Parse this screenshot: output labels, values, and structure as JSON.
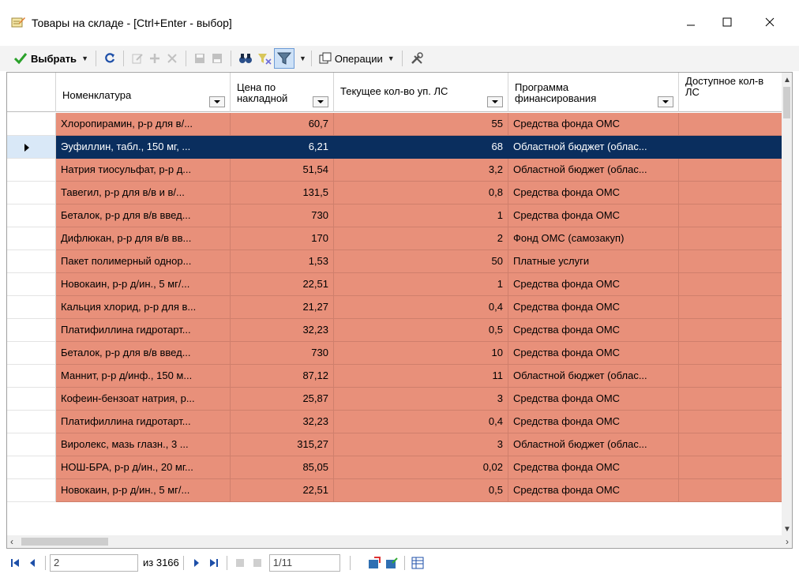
{
  "window": {
    "title": "Товары на складе - [Ctrl+Enter - выбор]",
    "icons": {
      "app": "notepad-pencil-icon",
      "minimize": "minimize-icon",
      "maximize": "maximize-icon",
      "close": "close-icon"
    }
  },
  "toolbar": {
    "select_label": "Выбрать",
    "operations_label": "Операции",
    "icons": [
      "checkmark-icon",
      "refresh-icon",
      "edit-icon",
      "add-icon",
      "delete-icon",
      "save-icon",
      "save-all-icon",
      "binoculars-icon",
      "filter-clear-icon",
      "filter-icon",
      "operations-icon",
      "tools-icon"
    ]
  },
  "grid": {
    "columns": [
      {
        "label": "Номенклатура"
      },
      {
        "label": "Цена по накладной"
      },
      {
        "label": "Текущее кол-во уп. ЛС"
      },
      {
        "label": "Программа финансирования"
      },
      {
        "label": "Доступное кол-в ЛС"
      }
    ],
    "rows": [
      {
        "name": "Хлоропирамин, р-р для в/...",
        "price": "60,7",
        "qty": "55",
        "program": "Средства фонда ОМС"
      },
      {
        "name": "Эуфиллин, табл., 150 мг, ...",
        "price": "6,21",
        "qty": "68",
        "program": "Областной бюджет (облас...",
        "selected": true
      },
      {
        "name": "Натрия тиосульфат, р-р д...",
        "price": "51,54",
        "qty": "3,2",
        "program": "Областной бюджет (облас..."
      },
      {
        "name": "Тавегил, р-р для в/в и в/...",
        "price": "131,5",
        "qty": "0,8",
        "program": "Средства фонда ОМС"
      },
      {
        "name": "Беталок, р-р для в/в введ...",
        "price": "730",
        "qty": "1",
        "program": "Средства фонда ОМС"
      },
      {
        "name": "Дифлюкан, р-р для в/в вв...",
        "price": "170",
        "qty": "2",
        "program": "Фонд ОМС (самозакуп)"
      },
      {
        "name": "Пакет полимерный однор...",
        "price": "1,53",
        "qty": "50",
        "program": "Платные услуги"
      },
      {
        "name": "Новокаин, р-р д/ин., 5 мг/...",
        "price": "22,51",
        "qty": "1",
        "program": "Средства фонда ОМС"
      },
      {
        "name": "Кальция хлорид, р-р для в...",
        "price": "21,27",
        "qty": "0,4",
        "program": "Средства фонда ОМС"
      },
      {
        "name": "Платифиллина гидротарт...",
        "price": "32,23",
        "qty": "0,5",
        "program": "Средства фонда ОМС"
      },
      {
        "name": "Беталок, р-р для в/в введ...",
        "price": "730",
        "qty": "10",
        "program": "Средства фонда ОМС"
      },
      {
        "name": "Маннит, р-р д/инф., 150 м...",
        "price": "87,12",
        "qty": "11",
        "program": "Областной бюджет (облас..."
      },
      {
        "name": "Кофеин-бензоат натрия, р...",
        "price": "25,87",
        "qty": "3",
        "program": "Средства фонда ОМС"
      },
      {
        "name": "Платифиллина гидротарт...",
        "price": "32,23",
        "qty": "0,4",
        "program": "Средства фонда ОМС"
      },
      {
        "name": "Виролекс, мазь глазн., 3 ...",
        "price": "315,27",
        "qty": "3",
        "program": "Областной бюджет (облас..."
      },
      {
        "name": "НОШ-БРА, р-р д/ин., 20 мг...",
        "price": "85,05",
        "qty": "0,02",
        "program": "Средства фонда ОМС"
      },
      {
        "name": "Новокаин, р-р д/ин., 5 мг/...",
        "price": "22,51",
        "qty": "0,5",
        "program": "Средства фонда ОМС"
      }
    ]
  },
  "navigator": {
    "current": "2",
    "total": "из 3166",
    "page": "1/11"
  },
  "colors": {
    "row_bg": "#e8907a",
    "selected_bg": "#0a2e5e"
  }
}
